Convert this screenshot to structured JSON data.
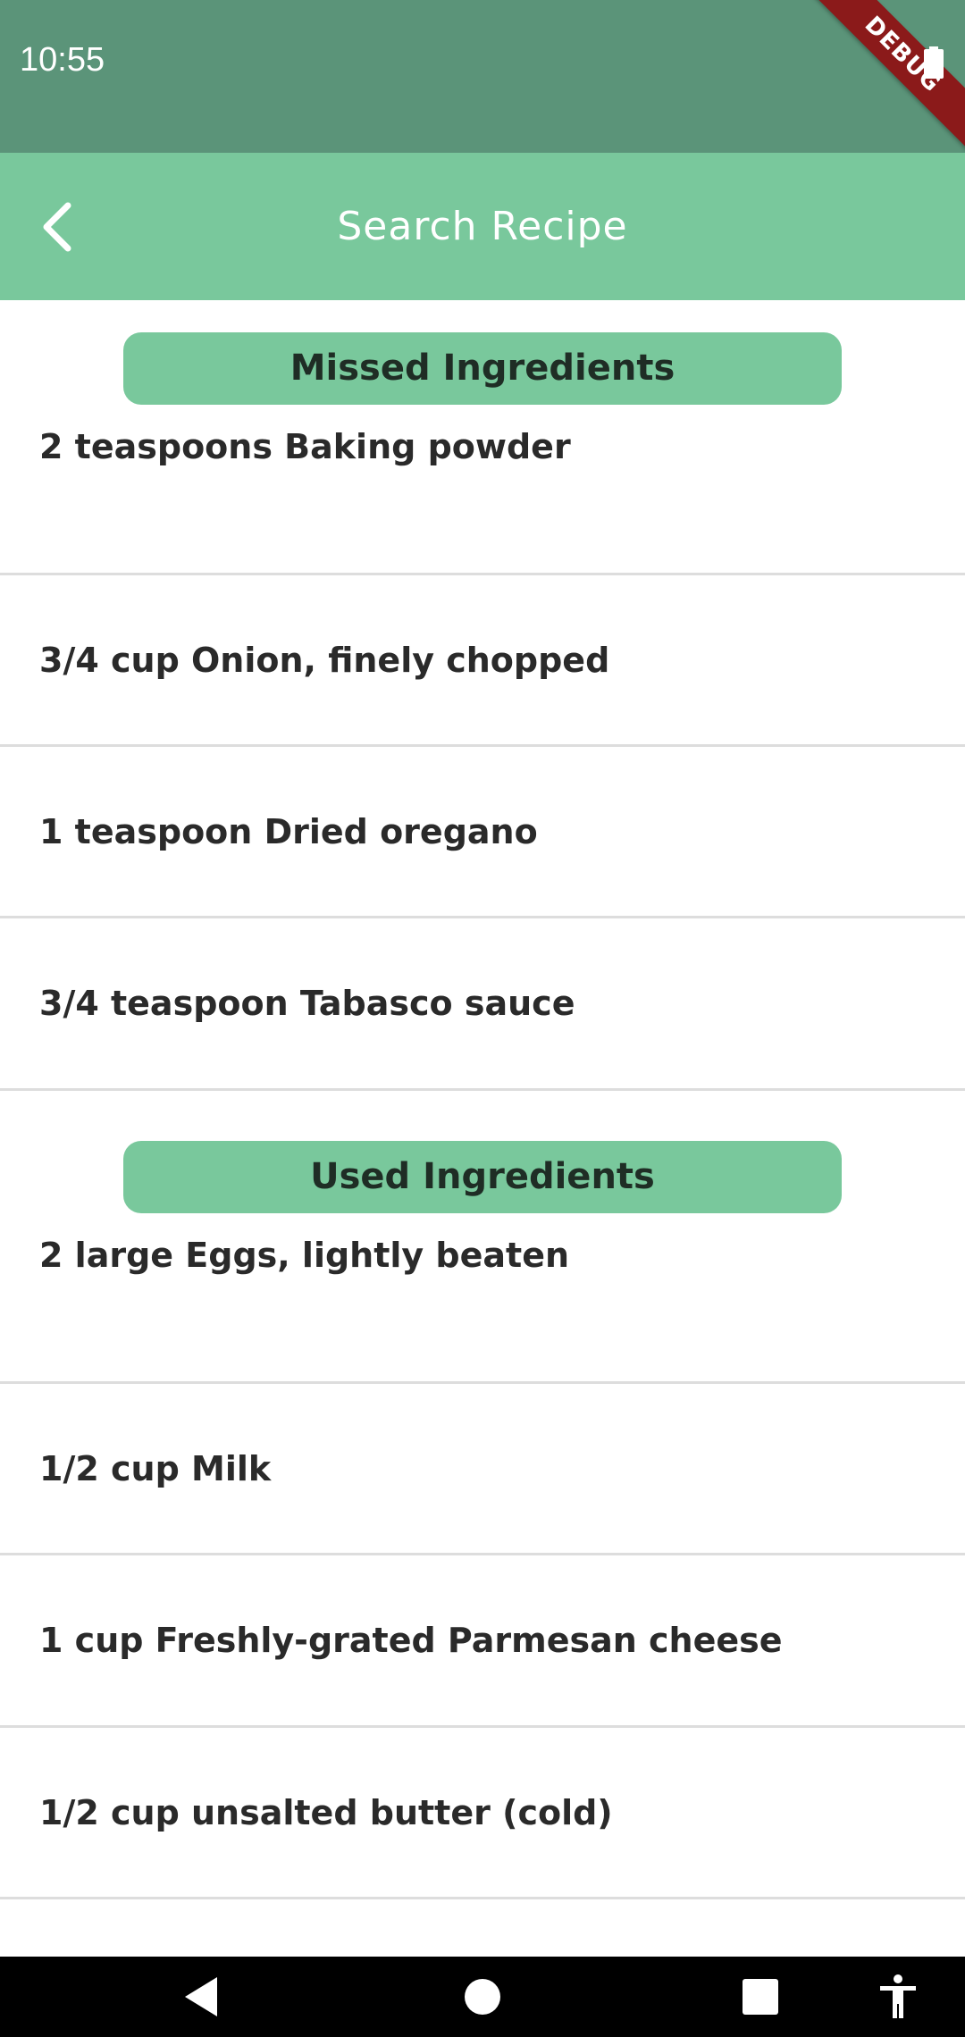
{
  "status_bar": {
    "time": "10:55",
    "battery_icon": "battery-icon",
    "debug_banner": "DEBUG"
  },
  "app_bar": {
    "title": "Search Recipe",
    "back_icon": "chevron-left-icon"
  },
  "missed": {
    "header": "Missed Ingredients",
    "items": [
      "2 teaspoons Baking powder",
      "3/4 cup Onion, finely chopped",
      "1 teaspoon Dried oregano",
      "3/4 teaspoon Tabasco sauce"
    ]
  },
  "used": {
    "header": "Used Ingredients",
    "items": [
      "2 large Eggs, lightly beaten",
      "1/2 cup Milk",
      "1 cup Freshly-grated Parmesan cheese",
      "1/2 cup unsalted butter (cold)"
    ]
  },
  "nav_bar": {
    "back_icon": "triangle-back-icon",
    "home_icon": "circle-home-icon",
    "recents_icon": "square-recents-icon",
    "accessibility_icon": "accessibility-icon"
  },
  "colors": {
    "status_bar": "#5b9479",
    "app_bar": "#79c89c",
    "header_pill": "#79c89c",
    "debug_ribbon": "#8b1a1a"
  }
}
